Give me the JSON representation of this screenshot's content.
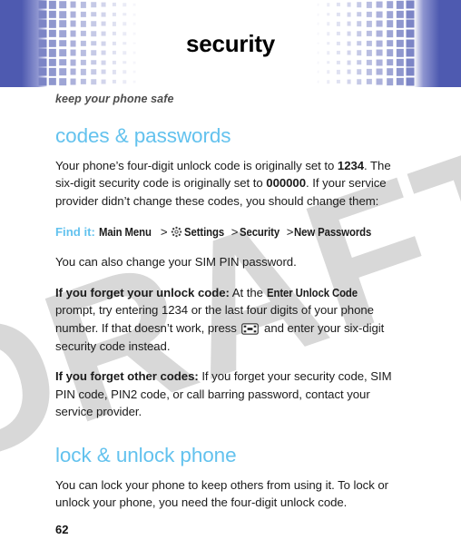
{
  "header": {
    "title": "security",
    "pattern_icon": "checkered-grid-pattern",
    "band_color": "#4e5ab0",
    "square_color": "#7c85c6"
  },
  "watermark": {
    "text": "DRAFT",
    "color": "#d8d8d8"
  },
  "content": {
    "subtitle": "keep your phone safe",
    "accent_color": "#63c2ee",
    "sections": [
      {
        "heading": "codes & passwords",
        "paragraph_1": {
          "part_1": "Your phone’s four-digit unlock code is originally set to ",
          "bold_1": "1234",
          "part_2": ". The six-digit security code is originally set to ",
          "bold_2": "000000",
          "part_3": ". If your service provider didn’t change these codes, you should change them:"
        },
        "finder": {
          "label": "Find it:",
          "step_1": "Main Menu",
          "separator_1": ">",
          "settings_icon": "settings-gear-icon",
          "step_2": "Settings",
          "separator_2": ">",
          "step_3": "Security",
          "separator_3": ">",
          "step_4": "New Passwords"
        },
        "paragraph_2": "You can also change your SIM PIN password.",
        "paragraph_3": {
          "bold_lead": "If you forget your unlock code:",
          "part_1": " At the ",
          "screen_label": "Enter Unlock Code",
          "part_2": " prompt, try entering 1234 or the last four digits of your phone number. If that doesn’t work, press ",
          "key_icon": "center-key-icon",
          "part_3": " and enter your six-digit security code instead."
        },
        "paragraph_4": {
          "bold_lead": "If you forget other codes:",
          "part_1": " If you forget your security code, SIM PIN code, PIN2 code, or call barring password, contact your service provider."
        }
      },
      {
        "heading": "lock & unlock phone",
        "paragraph_1": "You can lock your phone to keep others from using it. To lock or unlock your phone, you need the four-digit unlock code."
      }
    ]
  },
  "footer": {
    "page_number": "62"
  }
}
